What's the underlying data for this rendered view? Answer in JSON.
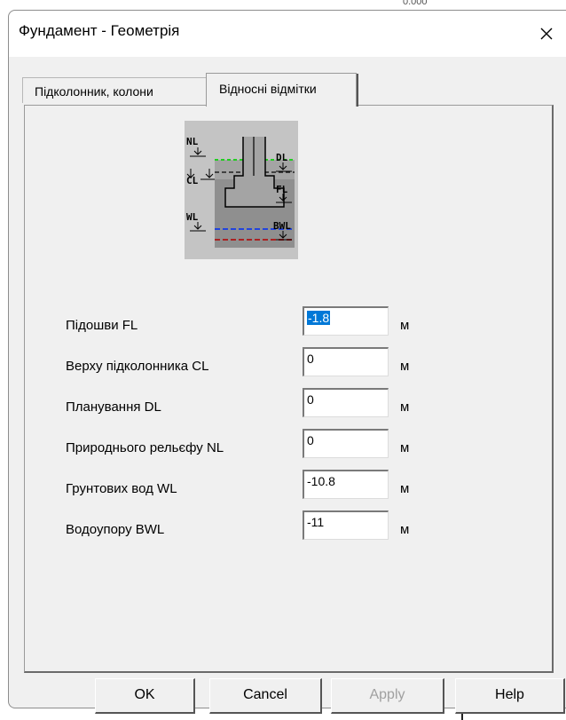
{
  "background": {
    "partial_text": "0.000"
  },
  "window": {
    "title": "Фундамент - Геометрія",
    "close_label": "×"
  },
  "tabs": [
    {
      "label": "Підколонник, колони",
      "active": false
    },
    {
      "label": "Відносні відмітки",
      "active": true
    }
  ],
  "diagram": {
    "labels": {
      "nl": "NL",
      "cl": "CL",
      "wl": "WL",
      "dl": "DL",
      "fl": "FL",
      "bwl": "BWL"
    }
  },
  "fields": [
    {
      "label": "Підошви  FL",
      "value": "-1.8",
      "unit": "м",
      "selected": true
    },
    {
      "label": "Верху підколонника CL",
      "value": "0",
      "unit": "м"
    },
    {
      "label": "Планування DL",
      "value": "0",
      "unit": "м"
    },
    {
      "label": "Природнього рельєфу NL",
      "value": "0",
      "unit": "м"
    },
    {
      "label": "Грунтових вод WL",
      "value": "-10.8",
      "unit": "м"
    },
    {
      "label": "Водоупору BWL",
      "value": "-11",
      "unit": "м"
    }
  ],
  "buttons": {
    "ok": "OK",
    "cancel": "Cancel",
    "apply": "Apply",
    "help": "Help"
  },
  "colors": {
    "selection": "#0078d7",
    "ground_line": "#22cc22",
    "water_line": "#2244dd",
    "aquiclude_line": "#aa2222"
  }
}
